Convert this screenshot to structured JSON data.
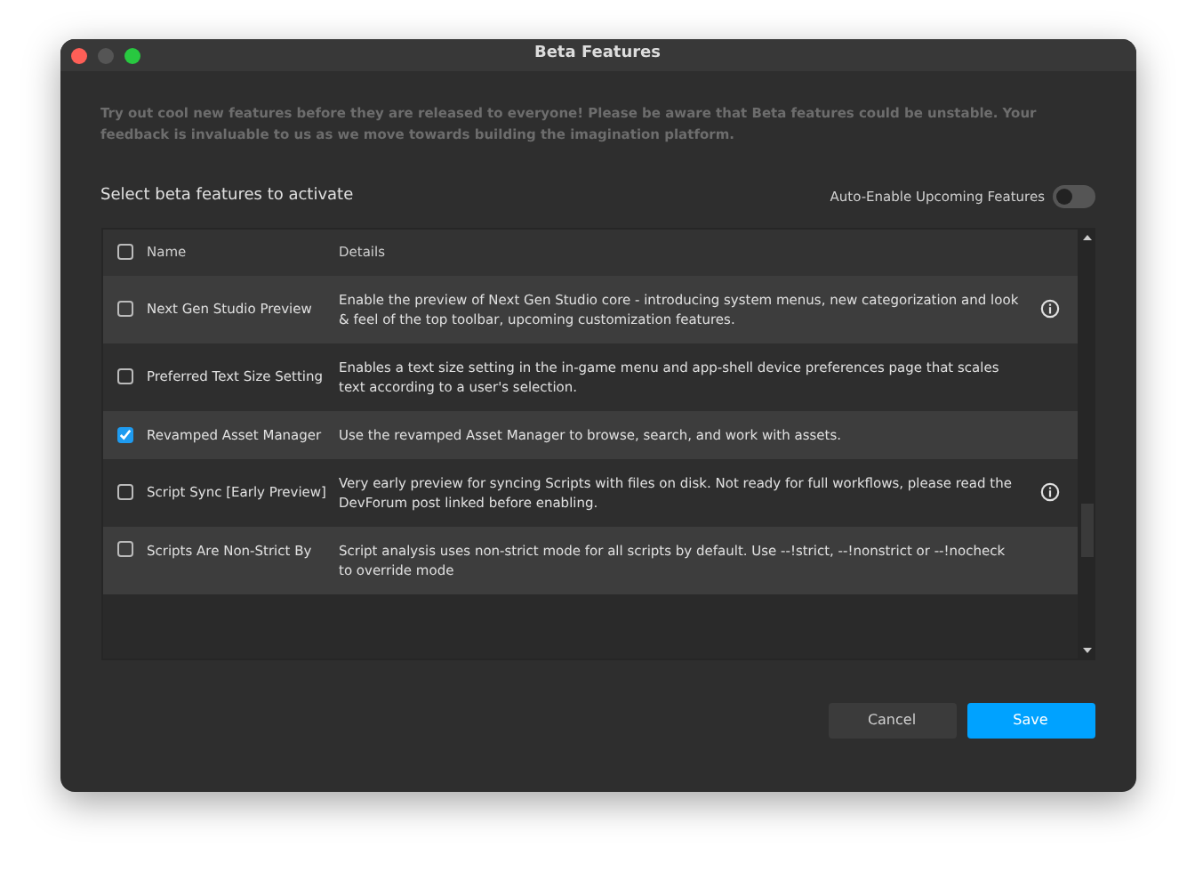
{
  "window": {
    "title": "Beta Features"
  },
  "intro": "Try out cool new features before they are released to everyone! Please be aware that Beta features could be unstable. Your feedback is invaluable to us as we move towards building the imagination platform.",
  "section_label": "Select beta features to activate",
  "auto_enable": {
    "label": "Auto-Enable Upcoming Features",
    "on": false
  },
  "table": {
    "select_all_checked": false,
    "columns": [
      "Name",
      "Details"
    ],
    "rows": [
      {
        "name": "Next Gen Studio Preview",
        "details": "Enable the preview of Next Gen Studio core - introducing system menus, new categorization and look & feel of the top toolbar, upcoming customization features.",
        "checked": false,
        "info": true
      },
      {
        "name": "Preferred Text Size Setting",
        "details": "Enables a text size setting in the in-game menu and app-shell device preferences page that scales text according to a user's selection.",
        "checked": false,
        "info": false
      },
      {
        "name": "Revamped Asset Manager",
        "details": "Use the revamped Asset Manager to browse, search, and work with assets.",
        "checked": true,
        "info": false
      },
      {
        "name": "Script Sync [Early Preview]",
        "details": "Very early preview for syncing Scripts with files on disk. Not ready for full workflows, please read the DevForum post linked before enabling.",
        "checked": false,
        "info": true
      },
      {
        "name": "Scripts Are Non-Strict By",
        "details": "Script analysis uses non-strict mode for all scripts by default. Use --!strict, --!nonstrict or --!nocheck to override mode",
        "checked": false,
        "info": false
      }
    ]
  },
  "buttons": [
    {
      "label": "Cancel",
      "kind": "secondary"
    },
    {
      "label": "Save",
      "kind": "primary"
    }
  ]
}
